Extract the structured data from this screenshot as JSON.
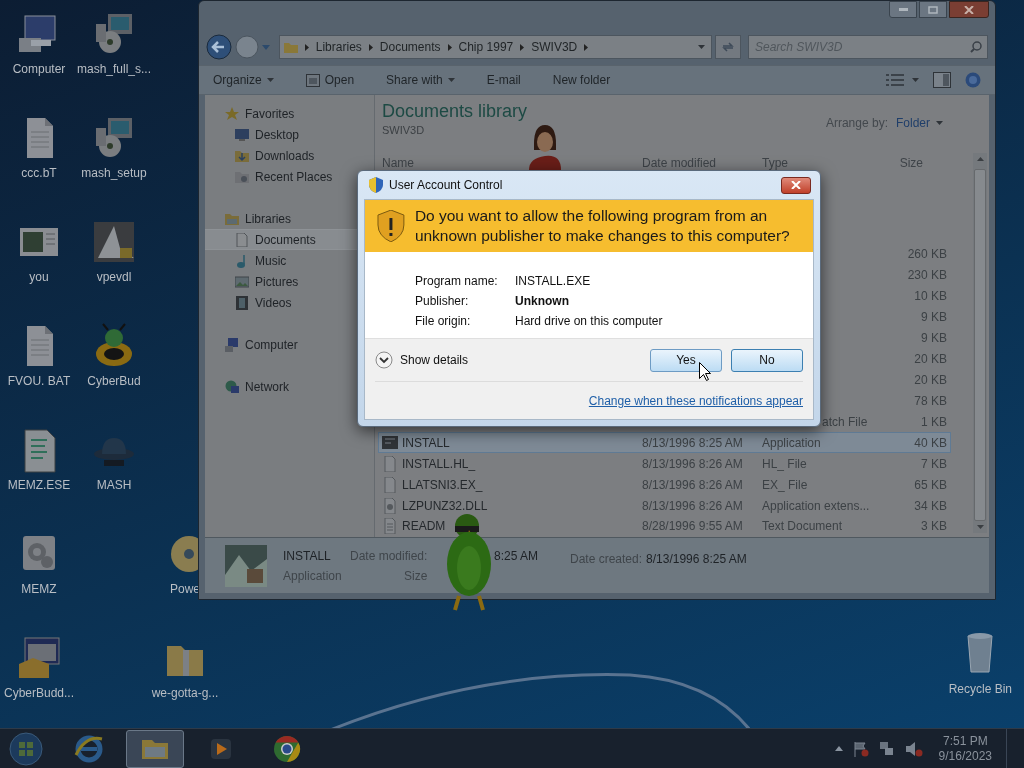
{
  "desktop_icons": [
    [
      {
        "label": "Computer",
        "kind": "computer"
      },
      {
        "label": "ccc.bT",
        "kind": "document"
      },
      {
        "label": "you",
        "kind": "window"
      },
      {
        "label": "FVOU. BAT",
        "kind": "document"
      },
      {
        "label": "MEMZ.ESE",
        "kind": "script"
      },
      {
        "label": "MEMZ",
        "kind": "gear"
      },
      {
        "label": "CyberBudd...",
        "kind": "package"
      }
    ],
    [
      {
        "label": "mash_full_s...",
        "kind": "installer"
      },
      {
        "label": "mash_setup",
        "kind": "installer"
      },
      {
        "label": "vpevdl",
        "kind": "image"
      },
      {
        "label": "CyberBud",
        "kind": "bug"
      },
      {
        "label": "MASH",
        "kind": "hat"
      }
    ],
    [
      {
        "label": "Powe",
        "kind": "disc"
      },
      {
        "label": "we-gotta-g...",
        "kind": "zip"
      }
    ]
  ],
  "recycle_bin": {
    "label": "Recycle Bin"
  },
  "explorer": {
    "breadcrumb": [
      "Libraries",
      "Documents",
      "Chip 1997",
      "SWIV3D"
    ],
    "search": {
      "placeholder": "Search SWIV3D"
    },
    "toolbar": [
      {
        "label": "Organize",
        "kind": "menu"
      },
      {
        "label": "Open",
        "kind": "open"
      },
      {
        "label": "Share with",
        "kind": "menu"
      },
      {
        "label": "E-mail",
        "kind": "plain"
      },
      {
        "label": "New folder",
        "kind": "plain"
      }
    ],
    "nav": [
      {
        "label": "Favorites",
        "kind": "star",
        "selected": false,
        "children": [
          {
            "label": "Desktop",
            "kind": "desktop",
            "selected": false
          },
          {
            "label": "Downloads",
            "kind": "downloads",
            "selected": false
          },
          {
            "label": "Recent Places",
            "kind": "recent",
            "selected": false
          }
        ]
      },
      {
        "label": "Libraries",
        "kind": "library",
        "selected": false,
        "children": [
          {
            "label": "Documents",
            "kind": "documents",
            "selected": true
          },
          {
            "label": "Music",
            "kind": "music",
            "selected": false
          },
          {
            "label": "Pictures",
            "kind": "pictures",
            "selected": false
          },
          {
            "label": "Videos",
            "kind": "videos",
            "selected": false
          }
        ]
      },
      {
        "label": "Computer",
        "kind": "computer",
        "selected": false
      },
      {
        "label": "Network",
        "kind": "network",
        "selected": false
      }
    ],
    "library": {
      "title": "Documents library",
      "subtitle": "SWIV3D",
      "arrange_label": "Arrange by:",
      "arrange_value": "Folder"
    },
    "columns": [
      "Name",
      "Date modified",
      "Type",
      "Size"
    ],
    "rows": [
      {
        "size": "260 KB",
        "selected": false
      },
      {
        "size": "230 KB",
        "selected": false
      },
      {
        "size": "10 KB",
        "selected": false
      },
      {
        "size": "9 KB",
        "selected": false
      },
      {
        "size": "9 KB",
        "selected": false
      },
      {
        "size": "20 KB",
        "selected": false
      },
      {
        "size": "20 KB",
        "selected": false
      },
      {
        "size": "78 KB",
        "selected": false
      },
      {
        "type": "atch File",
        "size": "1 KB",
        "selected": false
      },
      {
        "name": "INSTALL",
        "kind": "app",
        "date": "8/13/1996 8:25 AM",
        "type": "Application",
        "size": "40 KB",
        "selected": true
      },
      {
        "name": "INSTALL.HL_",
        "kind": "file",
        "date": "8/13/1996 8:26 AM",
        "type": "HL_ File",
        "size": "7 KB",
        "selected": false
      },
      {
        "name": "LLATSNI3.EX_",
        "kind": "file",
        "date": "8/13/1996 8:26 AM",
        "type": "EX_ File",
        "size": "65 KB",
        "selected": false
      },
      {
        "name": "LZPUNZ32.DLL",
        "kind": "dll",
        "date": "8/13/1996 8:26 AM",
        "type": "Application extens...",
        "size": "34 KB",
        "selected": false
      },
      {
        "name": "READM",
        "kind": "text",
        "date": "8/28/1996 9:55 AM",
        "type": "Text Document",
        "size": "3 KB",
        "selected": false
      }
    ],
    "details": {
      "name": "INSTALL",
      "type": "Application",
      "modified_label": "Date modified:",
      "modified_value": "8:25 AM",
      "size_label": "Size",
      "created_label": "Date created:",
      "created_value": "8/13/1996 8:25 AM"
    }
  },
  "uac": {
    "title": "User Account Control",
    "question": "Do you want to allow the following program from an unknown publisher to make changes to this computer?",
    "fields": [
      {
        "label": "Program name:",
        "value": "INSTALL.EXE",
        "bold": false
      },
      {
        "label": "Publisher:",
        "value": "Unknown",
        "bold": true
      },
      {
        "label": "File origin:",
        "value": "Hard drive on this computer",
        "bold": false
      }
    ],
    "details_toggle": "Show details",
    "buttons": [
      "Yes",
      "No"
    ],
    "link": "Change when these notifications appear"
  },
  "taskbar": {
    "items": [
      {
        "kind": "ie",
        "active": false
      },
      {
        "kind": "explorer",
        "active": true
      },
      {
        "kind": "media",
        "active": false
      },
      {
        "kind": "chrome",
        "active": false
      }
    ],
    "time": "7:51 PM",
    "date": "9/16/2023"
  }
}
